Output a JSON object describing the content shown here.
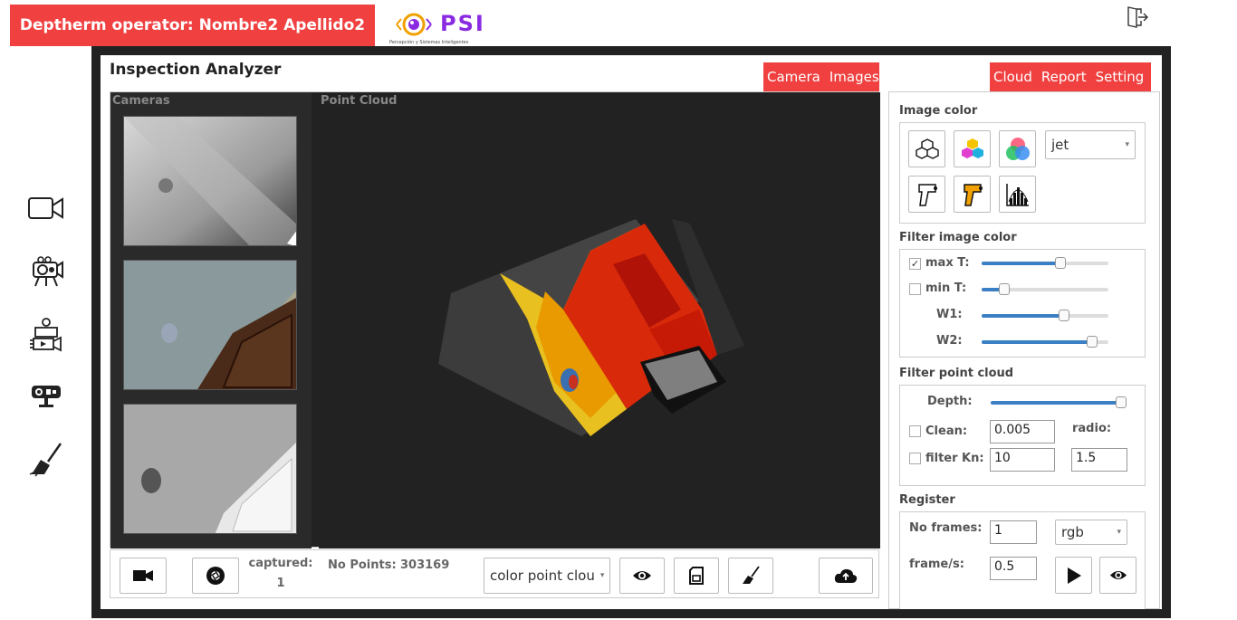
{
  "header": {
    "operator_label": "Deptherm operator: Nombre2 Apellido2",
    "logo_text": "PSI",
    "logo_subtitle": "Percepción y Sistemas Inteligentes"
  },
  "sidebar": {
    "icons": [
      "video-camera-icon",
      "camera-projector-icon",
      "camera-crew-icon",
      "depth-sensor-icon",
      "broom-icon"
    ]
  },
  "app": {
    "title": "Inspection Analyzer",
    "tabs_left": [
      "Camera",
      "Images"
    ],
    "tabs_right": [
      "Cloud",
      "Report",
      "Setting"
    ]
  },
  "views": {
    "cameras_label": "Cameras",
    "point_cloud_label": "Point Cloud"
  },
  "bottom_bar": {
    "captured_label": "captured:",
    "captured_value": "1",
    "points_label": "No Points:",
    "points_value": "303169",
    "color_mode": "color point clou"
  },
  "image_color": {
    "section_label": "Image color",
    "colormap": "jet"
  },
  "filter_image": {
    "section_label": "Filter image color",
    "max_t": {
      "label": "max T:",
      "checked": true,
      "value": 0.62
    },
    "min_t": {
      "label": "min T:",
      "checked": false,
      "value": 0.18
    },
    "w1": {
      "label": "W1:",
      "value": 0.65
    },
    "w2": {
      "label": "W2:",
      "value": 0.87
    }
  },
  "filter_cloud": {
    "section_label": "Filter point cloud",
    "depth": {
      "label": "Depth:",
      "value": 1.0
    },
    "clean": {
      "label": "Clean:",
      "checked": false,
      "value": "0.005"
    },
    "radio_label": "radio:",
    "radio_value": "1.5",
    "filter_kn": {
      "label": "filter Kn:",
      "checked": false,
      "value": "10"
    }
  },
  "register": {
    "section_label": "Register",
    "frames_label": "No frames:",
    "frames_value": "1",
    "color_space": "rgb",
    "fps_label": "frame/s:",
    "fps_value": "0.5"
  },
  "colors": {
    "accent": "#f04040",
    "slider": "#3b7fc4",
    "panel_dark": "#222222"
  }
}
